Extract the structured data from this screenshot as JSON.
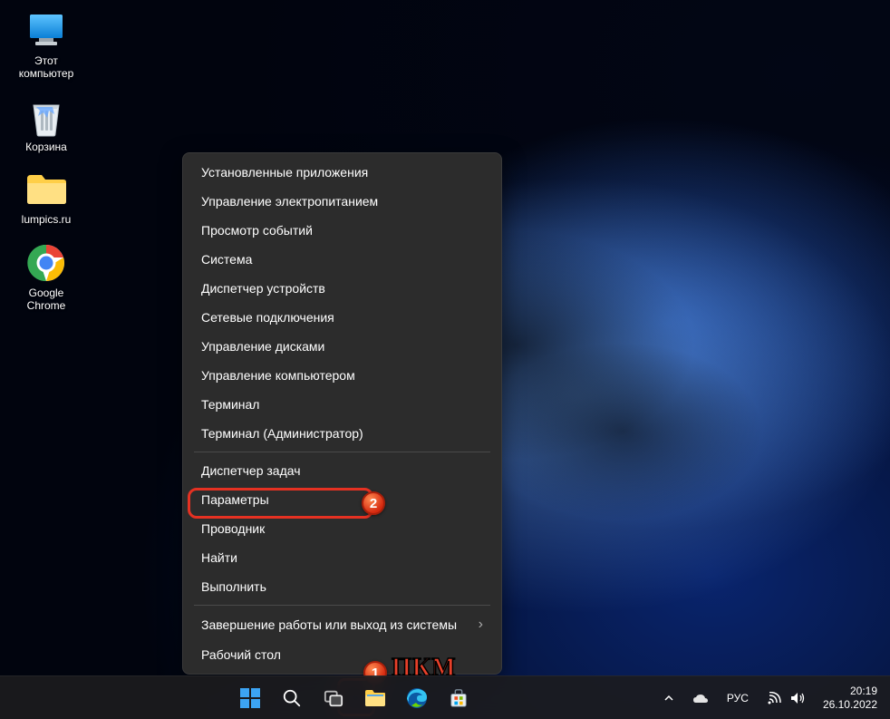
{
  "desktop_icons": [
    {
      "id": "this-pc",
      "label": "Этот\nкомпьютер"
    },
    {
      "id": "recycle",
      "label": "Корзина"
    },
    {
      "id": "lumpics",
      "label": "lumpics.ru"
    },
    {
      "id": "chrome",
      "label": "Google\nChrome"
    }
  ],
  "context_menu": {
    "groups": [
      [
        "Установленные приложения",
        "Управление электропитанием",
        "Просмотр событий",
        "Система",
        "Диспетчер устройств",
        "Сетевые подключения",
        "Управление дисками",
        "Управление компьютером",
        "Терминал",
        "Терминал (Администратор)"
      ],
      [
        "Диспетчер задач",
        "Параметры",
        "Проводник",
        "Найти",
        "Выполнить"
      ],
      [
        {
          "label": "Завершение работы или выход из системы",
          "submenu": true
        },
        "Рабочий стол"
      ]
    ]
  },
  "annotations": {
    "badge1": "1",
    "badge2": "2",
    "pkm": "ПКМ"
  },
  "system_tray": {
    "lang": "РУС",
    "time": "20:19",
    "date": "26.10.2022"
  }
}
